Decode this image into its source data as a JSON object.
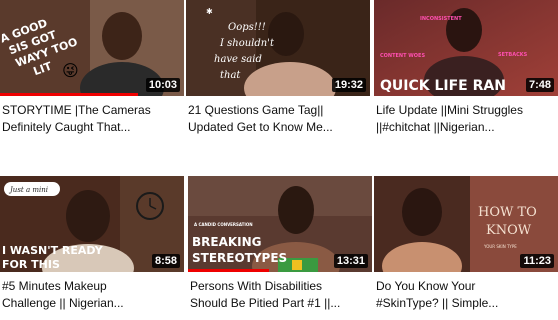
{
  "videos": [
    {
      "title_line1": "STORYTIME |The Cameras",
      "title_line2": "Definitely Caught That...",
      "duration": "10:03",
      "watched_fraction": 0.75,
      "thumb_lines": [
        "A GOOD",
        "SIS GOT",
        "WAYY TOO",
        "LIT"
      ],
      "thumb_emoji": "😜"
    },
    {
      "title_line1": "21 Questions Game Tag||",
      "title_line2": "Updated Get to Know Me...",
      "duration": "19:32",
      "thumb_lines": [
        "Oops!!!",
        "I shouldn't",
        "have said",
        "that"
      ]
    },
    {
      "title_line1": "Life Update ||Mini Struggles",
      "title_line2": "||#chitchat ||Nigerian...",
      "duration": "7:48",
      "thumb_main": "QUICK LIFE RAN",
      "thumb_tags": [
        "INCONSISTENT",
        "CONTENT WOES",
        "SETBACKS"
      ]
    },
    {
      "title_line1": "#5 Minutes Makeup",
      "title_line2": "Challenge || Nigerian...",
      "duration": "8:58",
      "thumb_bubble": "Just a mini",
      "thumb_lines": [
        "I WASN'T READY",
        "FOR THIS"
      ]
    },
    {
      "title_line1": "Persons With Disabilities",
      "title_line2": "Should Be Pitied Part #1 ||...",
      "duration": "13:31",
      "watched_fraction": 0.44,
      "thumb_small": "A CANDID CONVERSATION",
      "thumb_lines": [
        "BREAKING",
        "STEREOTYPES"
      ]
    },
    {
      "title_line1": "Do You Know Your",
      "title_line2": "#SkinType? || Simple...",
      "duration": "11:23",
      "thumb_lines": [
        "HOW TO",
        "KNOW"
      ],
      "thumb_small": "YOUR SKIN TYPE"
    }
  ],
  "colors": {
    "progress": "#ee0000",
    "duration_bg": "#000000"
  }
}
